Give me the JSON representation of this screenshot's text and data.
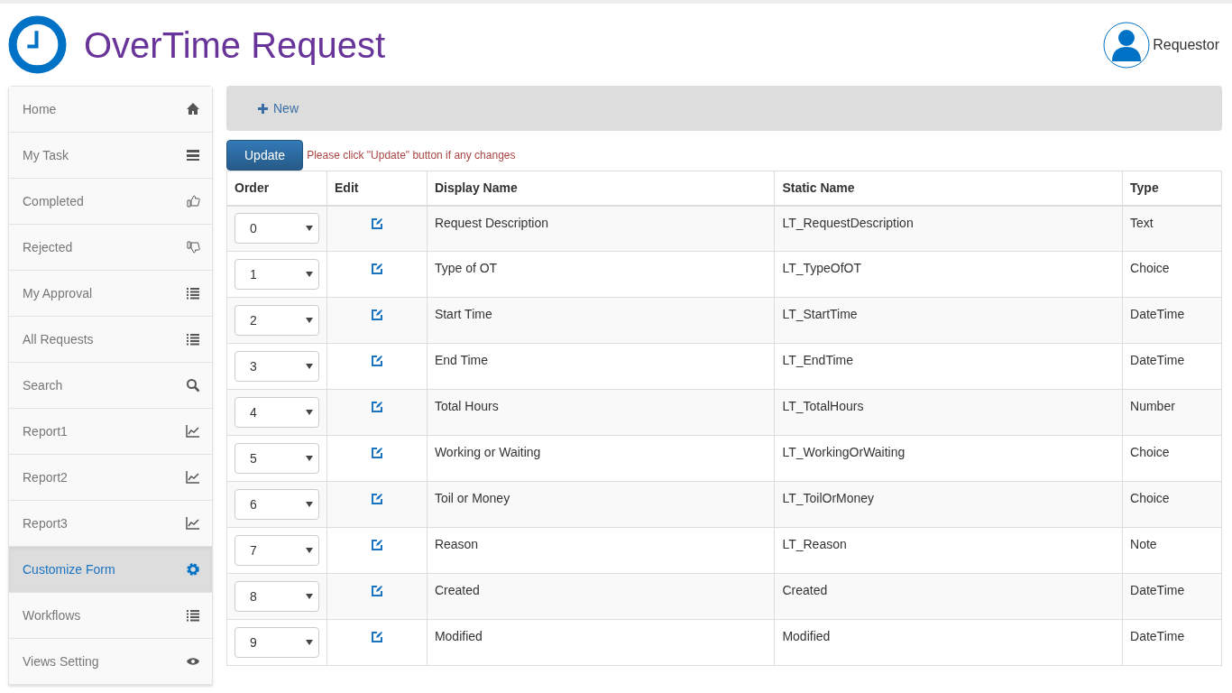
{
  "app": {
    "title": "OverTime Request",
    "user": "Requestor"
  },
  "sidebar": {
    "items": [
      {
        "label": "Home",
        "kind": "home",
        "selected": false
      },
      {
        "label": "My Task",
        "kind": "tasks",
        "selected": false
      },
      {
        "label": "Completed",
        "kind": "thumbsup",
        "selected": false
      },
      {
        "label": "Rejected",
        "kind": "thumbsdown",
        "selected": false
      },
      {
        "label": "My Approval",
        "kind": "list",
        "selected": false
      },
      {
        "label": "All Requests",
        "kind": "list",
        "selected": false
      },
      {
        "label": "Search",
        "kind": "search",
        "selected": false
      },
      {
        "label": "Report1",
        "kind": "chart",
        "selected": false
      },
      {
        "label": "Report2",
        "kind": "chart",
        "selected": false
      },
      {
        "label": "Report3",
        "kind": "chart",
        "selected": false
      },
      {
        "label": "Customize Form",
        "kind": "gear",
        "selected": true
      },
      {
        "label": "Workflows",
        "kind": "list",
        "selected": false
      },
      {
        "label": "Views Setting",
        "kind": "eye",
        "selected": false
      }
    ]
  },
  "toolbar": {
    "new_button": "New"
  },
  "update_button": "Update",
  "hint": "Please click \"Update\" button if any changes",
  "table": {
    "columns": [
      "Order",
      "Edit",
      "Display Name",
      "Static Name",
      "Type"
    ],
    "rows": [
      {
        "order": "0",
        "display_name": "Request Description",
        "static_name": "LT_RequestDescription",
        "type": "Text"
      },
      {
        "order": "1",
        "display_name": "Type of OT",
        "static_name": "LT_TypeOfOT",
        "type": "Choice"
      },
      {
        "order": "2",
        "display_name": "Start Time",
        "static_name": "LT_StartTime",
        "type": "DateTime"
      },
      {
        "order": "3",
        "display_name": "End Time",
        "static_name": "LT_EndTime",
        "type": "DateTime"
      },
      {
        "order": "4",
        "display_name": "Total Hours",
        "static_name": "LT_TotalHours",
        "type": "Number"
      },
      {
        "order": "5",
        "display_name": "Working or Waiting",
        "static_name": "LT_WorkingOrWaiting",
        "type": "Choice"
      },
      {
        "order": "6",
        "display_name": "Toil or Money",
        "static_name": "LT_ToilOrMoney",
        "type": "Choice"
      },
      {
        "order": "7",
        "display_name": "Reason",
        "static_name": "LT_Reason",
        "type": "Note"
      },
      {
        "order": "8",
        "display_name": "Created",
        "static_name": "Created",
        "type": "DateTime"
      },
      {
        "order": "9",
        "display_name": "Modified",
        "static_name": "Modified",
        "type": "DateTime"
      }
    ]
  }
}
